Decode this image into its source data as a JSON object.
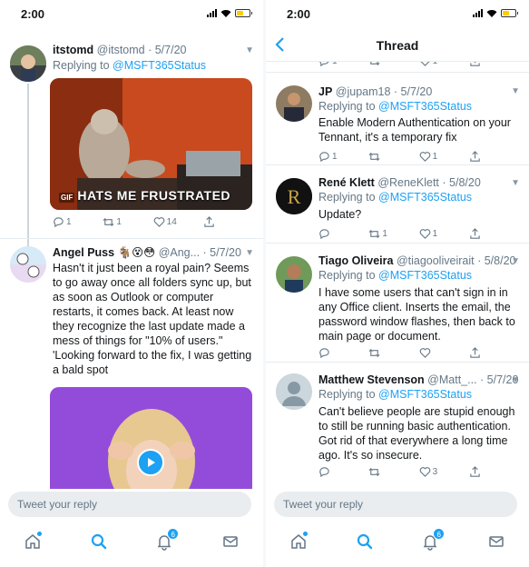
{
  "left": {
    "status": {
      "time": "2:00"
    },
    "tweets": [
      {
        "name": "itstomd",
        "handle": "@itstomd",
        "date": "· 5/7/20",
        "replying_prefix": "Replying to",
        "mention": "@MSFT365Status",
        "media_caption": "HATS ME FRUSTRATED",
        "media_badge": "GIF",
        "replies": "1",
        "retweets": "1",
        "likes": "14"
      },
      {
        "name": "Angel Puss",
        "emoji": "🐐😵😳",
        "handle": "@Ang...",
        "date": "· 5/7/20",
        "text": "Hasn't it just been a royal pain? Seems to go away once all folders sync up, but as soon as Outlook or computer restarts, it comes back. At least now they recognize the last update made a mess of things for \"10% of users.\" 'Looking forward to the fix, I was getting a bald spot"
      }
    ],
    "reply_placeholder": "Tweet your reply",
    "notifications_badge": "6"
  },
  "right": {
    "status": {
      "time": "2:00"
    },
    "title": "Thread",
    "top_actions": {
      "replies": "1",
      "retweets": "",
      "likes": "1"
    },
    "tweets": [
      {
        "name": "JP",
        "handle": "@jupam18",
        "date": "· 5/7/20",
        "replying_prefix": "Replying to",
        "mention": "@MSFT365Status",
        "text": "Enable Modern Authentication on your Tennant, it's a temporary fix",
        "replies": "1",
        "retweets": "",
        "likes": "1"
      },
      {
        "name": "René Klett",
        "handle": "@ReneKlett",
        "date": "· 5/8/20",
        "replying_prefix": "Replying to",
        "mention": "@MSFT365Status",
        "text": "Update?",
        "replies": "",
        "retweets": "1",
        "likes": "1"
      },
      {
        "name": "Tiago Oliveira",
        "handle": "@tiagooliveirait",
        "date": "· 5/8/20",
        "replying_prefix": "Replying to",
        "mention": "@MSFT365Status",
        "text": "I have some users that can't sign in in any Office client. Inserts the email, the password window flashes, then back to main page or document.",
        "replies": "",
        "retweets": "",
        "likes": ""
      },
      {
        "name": "Matthew Stevenson",
        "handle": "@Matt_...",
        "date": "· 5/7/20",
        "replying_prefix": "Replying to",
        "mention": "@MSFT365Status",
        "text": "Can't believe people are stupid enough to still be running basic authentication. Got rid of that everywhere a long time ago. It's so insecure.",
        "replies": "",
        "retweets": "",
        "likes": "3"
      }
    ],
    "reply_placeholder": "Tweet your reply",
    "notifications_badge": "6"
  },
  "colors": {
    "accent": "#1da1f2",
    "muted": "#657786",
    "border": "#e6ecf0",
    "battery": "#ffcc00"
  },
  "icons": [
    "chevron-left-icon",
    "chevron-down-icon",
    "reply-icon",
    "retweet-icon",
    "like-icon",
    "share-icon",
    "home-icon",
    "search-icon",
    "bell-icon",
    "mail-icon",
    "play-icon"
  ]
}
